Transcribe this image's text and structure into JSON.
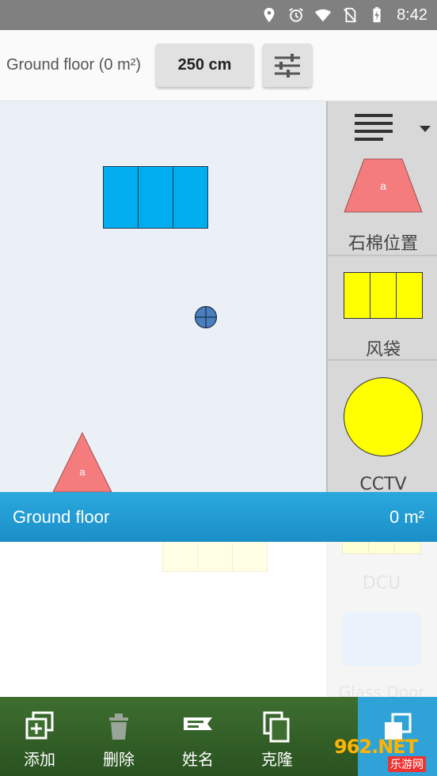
{
  "status_bar": {
    "time": "8:42",
    "icons": [
      "location-icon",
      "alarm-icon",
      "wifi-icon",
      "no-sim-icon",
      "battery-charging-icon"
    ]
  },
  "toolbar": {
    "floor_label": "Ground floor (0 m²)",
    "height_value": "250 cm",
    "settings_icon": "sliders-icon"
  },
  "palette": {
    "menu_icon": "list-icon",
    "items": [
      {
        "label": "石棉位置",
        "glyph": "a",
        "color": "#f47c7c",
        "shape": "trapezoid"
      },
      {
        "label": "风袋",
        "color": "#ffff00",
        "shape": "rect-3"
      },
      {
        "label": "CCTV",
        "color": "#ffff00",
        "shape": "circle"
      },
      {
        "label": "DCU",
        "color": "#ffffcc",
        "shape": "rect-3"
      },
      {
        "label": "Glass Door",
        "color": "#d4e8fb",
        "shape": "rounded-rect"
      }
    ]
  },
  "canvas": {
    "items": [
      {
        "kind": "blue-block",
        "color": "#00aeef"
      },
      {
        "kind": "crosshair-marker",
        "color": "#4a7fbd"
      },
      {
        "kind": "red-triangle",
        "glyph": "a",
        "color": "#f47c7c"
      },
      {
        "kind": "yellow-block-faded",
        "color": "#ffffcc"
      }
    ]
  },
  "floor_bar": {
    "name": "Ground floor",
    "area": "0 m²"
  },
  "bottom_nav": {
    "items": [
      {
        "label": "添加",
        "icon": "add-layers-icon"
      },
      {
        "label": "删除",
        "icon": "trash-icon"
      },
      {
        "label": "姓名",
        "icon": "rename-icon"
      },
      {
        "label": "克隆",
        "icon": "clone-icon"
      }
    ],
    "layers_icon": "layers-icon"
  },
  "watermark": {
    "text": "962.NET",
    "sub": "乐游网"
  },
  "colors": {
    "accent": "#2aa9df",
    "nav_bg": "#3d6e2f",
    "canvas_bg": "#eaf0f5"
  }
}
